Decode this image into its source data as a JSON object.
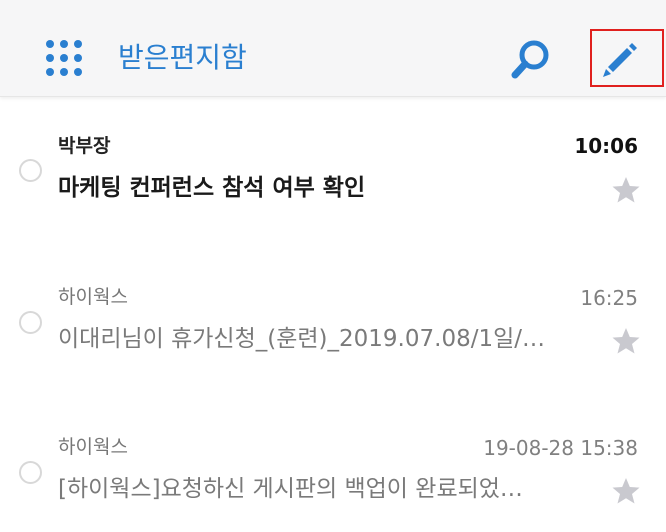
{
  "header": {
    "title": "받은편지함",
    "menu_icon": "grid-menu-icon",
    "search_icon": "search-icon",
    "compose_icon": "pencil-icon"
  },
  "colors": {
    "accent": "#2a7fd0",
    "highlight_border": "#e0201e",
    "star": "#c9c9cf"
  },
  "mails": [
    {
      "sender": "박부장",
      "subject": "마케팅 컨퍼런스 참석 여부 확인",
      "time": "10:06",
      "unread": true
    },
    {
      "sender": "하이웍스",
      "subject": "이대리님이 휴가신청_(훈련)_2019.07.08/1일/…",
      "time": "16:25",
      "unread": false
    },
    {
      "sender": "하이웍스",
      "subject": "[하이웍스]요청하신 게시판의 백업이 완료되었…",
      "time": "19-08-28 15:38",
      "unread": false
    }
  ]
}
